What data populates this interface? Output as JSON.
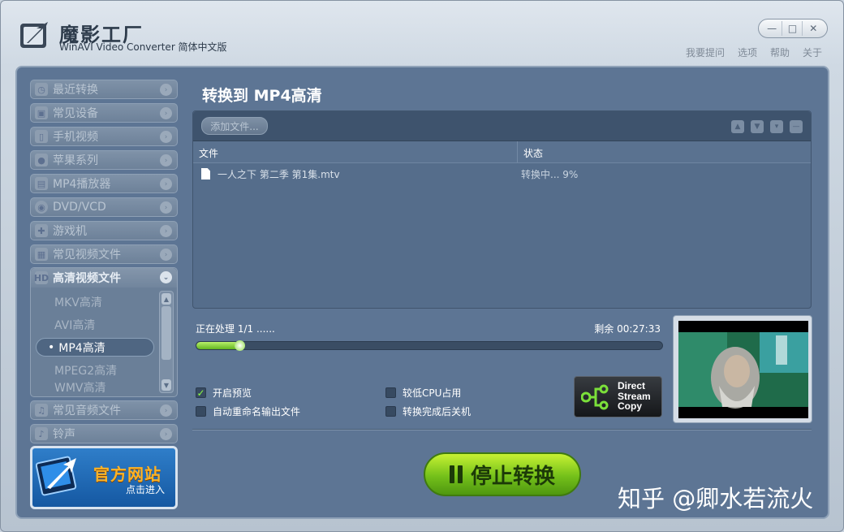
{
  "app": {
    "title_cn": "魔影工厂",
    "subtitle": "WinAVI Video Converter 简体中文版"
  },
  "window_controls": {
    "minimize": "—",
    "maximize": "□",
    "close": "✕"
  },
  "top_links": [
    "我要提问",
    "选项",
    "帮助",
    "关于"
  ],
  "sidebar": {
    "items": [
      {
        "label": "最近转换",
        "icon": "clock-icon"
      },
      {
        "label": "常见设备",
        "icon": "device-icon"
      },
      {
        "label": "手机视频",
        "icon": "phone-icon"
      },
      {
        "label": "苹果系列",
        "icon": "apple-icon"
      },
      {
        "label": "MP4播放器",
        "icon": "mp4-icon"
      },
      {
        "label": "DVD/VCD",
        "icon": "disc-icon"
      },
      {
        "label": "游戏机",
        "icon": "gamepad-icon"
      },
      {
        "label": "常见视频文件",
        "icon": "film-icon"
      }
    ],
    "expanded": {
      "label": "高清视频文件",
      "sub_items": [
        "MKV高清",
        "AVI高清",
        "MP4高清",
        "MPEG2高清",
        "WMV高清"
      ],
      "active_index": 2
    },
    "items_after": [
      {
        "label": "常见音频文件",
        "icon": "audio-icon"
      },
      {
        "label": "铃声",
        "icon": "bell-icon"
      }
    ]
  },
  "promo": {
    "title": "官方网站",
    "sub": "点击进入"
  },
  "content": {
    "title": "转换到 MP4高清",
    "add_file": "添加文件...",
    "columns": {
      "file": "文件",
      "status": "状态"
    },
    "files": [
      {
        "name": "一人之下 第二季 第1集.mtv",
        "status": "转换中... 9%"
      }
    ]
  },
  "progress": {
    "label": "正在处理 1/1 ......",
    "remaining": "剩余 00:27:33",
    "fraction": 0.09
  },
  "options": {
    "preview": {
      "label": "开启预览",
      "checked": true
    },
    "auto_rename": {
      "label": "自动重命名输出文件",
      "checked": false
    },
    "low_cpu": {
      "label": "较低CPU占用",
      "checked": false
    },
    "shutdown": {
      "label": "转换完成后关机",
      "checked": false
    }
  },
  "dsc": {
    "line1": "Direct",
    "line2": "Stream",
    "line3": "Copy"
  },
  "stop_button": "停止转换",
  "watermark": "知乎 @卿水若流火",
  "colors": {
    "panel": "#5d7594",
    "accent_green": "#74c01a"
  }
}
